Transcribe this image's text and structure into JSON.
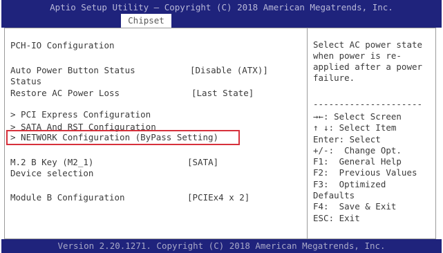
{
  "header": {
    "title": "Aptio Setup Utility – Copyright (C) 2018 American Megatrends, Inc.",
    "active_tab": "Chipset"
  },
  "main": {
    "section_title": "PCH-IO Configuration",
    "settings": [
      {
        "label": "Auto Power Button Status",
        "value": "[Disable (ATX)]"
      },
      {
        "label": "Status",
        "value": ""
      },
      {
        "label": "Restore AC Power Loss",
        "value": "[Last State]"
      }
    ],
    "submenus": [
      "> PCI Express Configuration",
      "> SATA And RST Configuration",
      "> NETWORK Configuration (ByPass Setting)"
    ],
    "m2": {
      "label": "M.2 B Key (M2_1)",
      "sub_label": "Device selection",
      "value": "[SATA]"
    },
    "module_b": {
      "label": "Module B Configuration",
      "value": "[PCIEx4 x 2]"
    }
  },
  "help": {
    "lines": [
      "Select AC power state",
      "when power is re-",
      "applied after a power",
      "failure."
    ],
    "separator": "---------------------",
    "keys": [
      "→←: Select Screen",
      "↑ ↓: Select Item",
      "Enter: Select",
      "+/-:  Change Opt.",
      "F1:  General Help",
      "F2:  Previous Values",
      "F3:  Optimized",
      "Defaults",
      "F4:  Save & Exit",
      "ESC: Exit"
    ]
  },
  "footer": {
    "text": "Version 2.20.1271. Copyright (C) 2018 American Megatrends, Inc."
  },
  "colors": {
    "header_bg": "#1f237c",
    "selection_border": "#d6303b",
    "text": "#3a3a3a"
  }
}
